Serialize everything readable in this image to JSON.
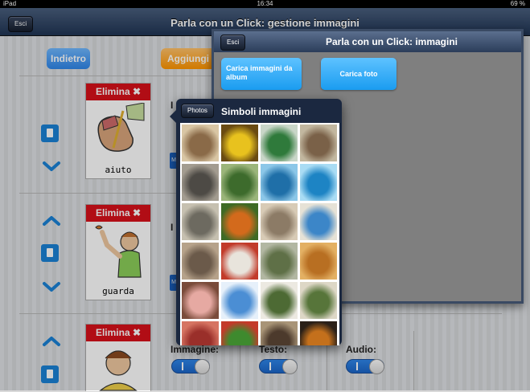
{
  "status": {
    "device": "iPad",
    "time": "16:34",
    "battery": "69 %"
  },
  "nav": {
    "exit_label": "Esci",
    "title": "Parla con un Click: gestione immagini"
  },
  "toolbar": {
    "back_label": "Indietro",
    "add_label": "Aggiungi"
  },
  "rows": [
    {
      "delete_label": "Elimina",
      "word": "aiuto"
    },
    {
      "delete_label": "Elimina",
      "word": "guarda"
    },
    {
      "delete_label": "Elimina",
      "word": ""
    }
  ],
  "fields": {
    "image_label": "Immagine:",
    "text_label": "Testo:",
    "audio_label": "Audio:",
    "toggle_on": "I"
  },
  "modal": {
    "exit_label": "Esci",
    "title": "Parla con un Click: immagini",
    "load_album_label": "Carica immagini da album",
    "load_photo_label": "Carica foto"
  },
  "popover": {
    "back_label": "Photos",
    "title": "Simboli immagini",
    "thumbnails": [
      {
        "name": "kitchen",
        "c1": "#8a6a48",
        "c2": "#d9c6a4"
      },
      {
        "name": "bananas",
        "c1": "#e8c21e",
        "c2": "#6a4b12"
      },
      {
        "name": "bottle",
        "c1": "#2f7a3b",
        "c2": "#c9d6c8"
      },
      {
        "name": "office",
        "c1": "#7a6148",
        "c2": "#c2b79f"
      },
      {
        "name": "desk",
        "c1": "#4d4a45",
        "c2": "#a39c90"
      },
      {
        "name": "ducks",
        "c1": "#3d6b2c",
        "c2": "#9bb57a"
      },
      {
        "name": "dolphin",
        "c1": "#1f6fa8",
        "c2": "#8cc7e8"
      },
      {
        "name": "dolphins",
        "c1": "#1d84c4",
        "c2": "#a9dcf4"
      },
      {
        "name": "elephant",
        "c1": "#6d6a60",
        "c2": "#c6c0b0"
      },
      {
        "name": "butterfly",
        "c1": "#d36a1c",
        "c2": "#3e6a25"
      },
      {
        "name": "cat",
        "c1": "#8c7b66",
        "c2": "#d8cbb6"
      },
      {
        "name": "hotel",
        "c1": "#3c86c8",
        "c2": "#e6e2d6"
      },
      {
        "name": "hippo",
        "c1": "#6b5a4a",
        "c2": "#b6a28a"
      },
      {
        "name": "clown",
        "c1": "#e8e4dc",
        "c2": "#c23b2a"
      },
      {
        "name": "koala",
        "c1": "#5f7047",
        "c2": "#b2b7a2"
      },
      {
        "name": "lion",
        "c1": "#b86f22",
        "c2": "#e3b063"
      },
      {
        "name": "pig",
        "c1": "#e6a9a2",
        "c2": "#7a4b3a"
      },
      {
        "name": "clouds",
        "c1": "#4b8ed4",
        "c2": "#e6f0fa"
      },
      {
        "name": "goose",
        "c1": "#4d6a34",
        "c2": "#ece9e1"
      },
      {
        "name": "sheep",
        "c1": "#57753a",
        "c2": "#ddd7c6"
      },
      {
        "name": "rug",
        "c1": "#9a2f2a",
        "c2": "#d67462"
      },
      {
        "name": "frog",
        "c1": "#3e8a2e",
        "c2": "#c33a2a"
      },
      {
        "name": "monkey",
        "c1": "#4c3a2c",
        "c2": "#a89477"
      },
      {
        "name": "tiger",
        "c1": "#c4701c",
        "c2": "#2a2018"
      }
    ]
  }
}
